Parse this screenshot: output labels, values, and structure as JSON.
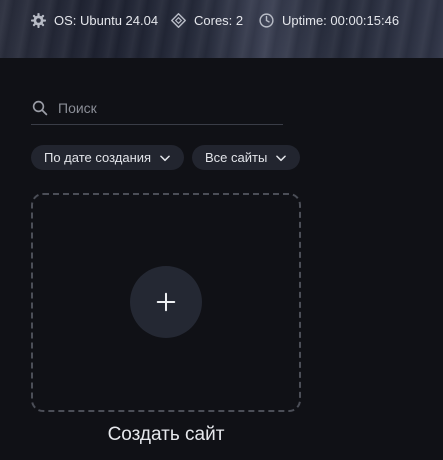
{
  "topbar": {
    "os": {
      "icon": "gear-icon",
      "text": "OS: Ubuntu 24.04"
    },
    "cores": {
      "icon": "diamond-icon",
      "text": "Cores: 2"
    },
    "uptime": {
      "icon": "clock-icon",
      "text": "Uptime: 00:00:15:46"
    }
  },
  "search": {
    "placeholder": "Поиск",
    "value": "",
    "icon": "search-icon"
  },
  "filters": {
    "sort": {
      "label": "По дате создания",
      "icon": "chevron-down-icon"
    },
    "scope": {
      "label": "Все сайты",
      "icon": "chevron-down-icon"
    }
  },
  "create_site": {
    "label": "Создать сайт",
    "icon": "plus-icon"
  },
  "colors": {
    "background": "#101116",
    "card_border": "#4b4e57",
    "chip_bg": "#22252f",
    "circle_bg": "#242833"
  }
}
